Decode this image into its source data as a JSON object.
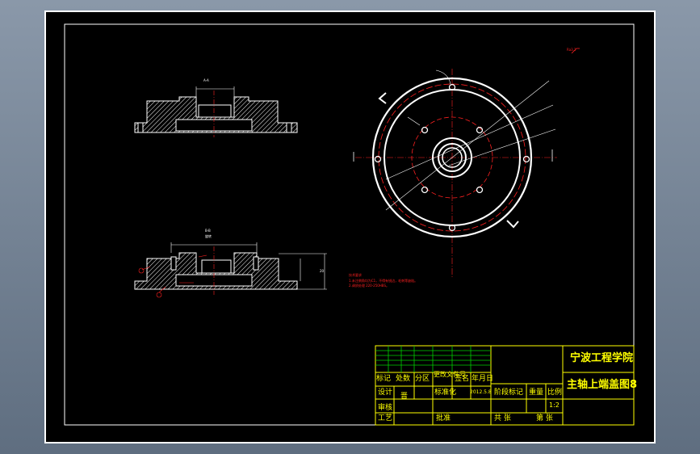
{
  "drawing": {
    "institution": "宁波工程学院",
    "drawing_title": "主轴上端盖图8",
    "titleblock": {
      "mark_header": "标记",
      "count_header": "处数",
      "zone_header": "分区",
      "change_doc_header": "更改文件号",
      "sign_header": "签名",
      "date_header": "年月日",
      "design_label": "设计",
      "designer_name": "晋",
      "standardize_label": "标准化",
      "date_value": "2012.5.8",
      "stage_mark_label": "阶段标记",
      "weight_label": "重量",
      "scale_label": "比例",
      "scale_value": "1:2",
      "review_label": "审核",
      "process_label": "工艺",
      "approve_label": "批准",
      "total_sheets_label": "共 张",
      "sheet_no_label": "第 张"
    },
    "tech_notes": {
      "heading": "技术要求",
      "line1": "1.未注倒角均为C1，不得有锐边，毛刺等缺陷。",
      "line2": "2.调质处理 220-250HBS。"
    },
    "view_labels": {
      "section_aa": "A-A",
      "section_bb": "B-B",
      "rotated": "旋转",
      "top_tag": "Ra3.2",
      "dim_height": "20"
    },
    "colors": {
      "background": "#000000",
      "outline": "#ffffff",
      "center_line": "#ff2020",
      "title_block": "#ffff00",
      "frame_grid": "#00d000"
    }
  }
}
